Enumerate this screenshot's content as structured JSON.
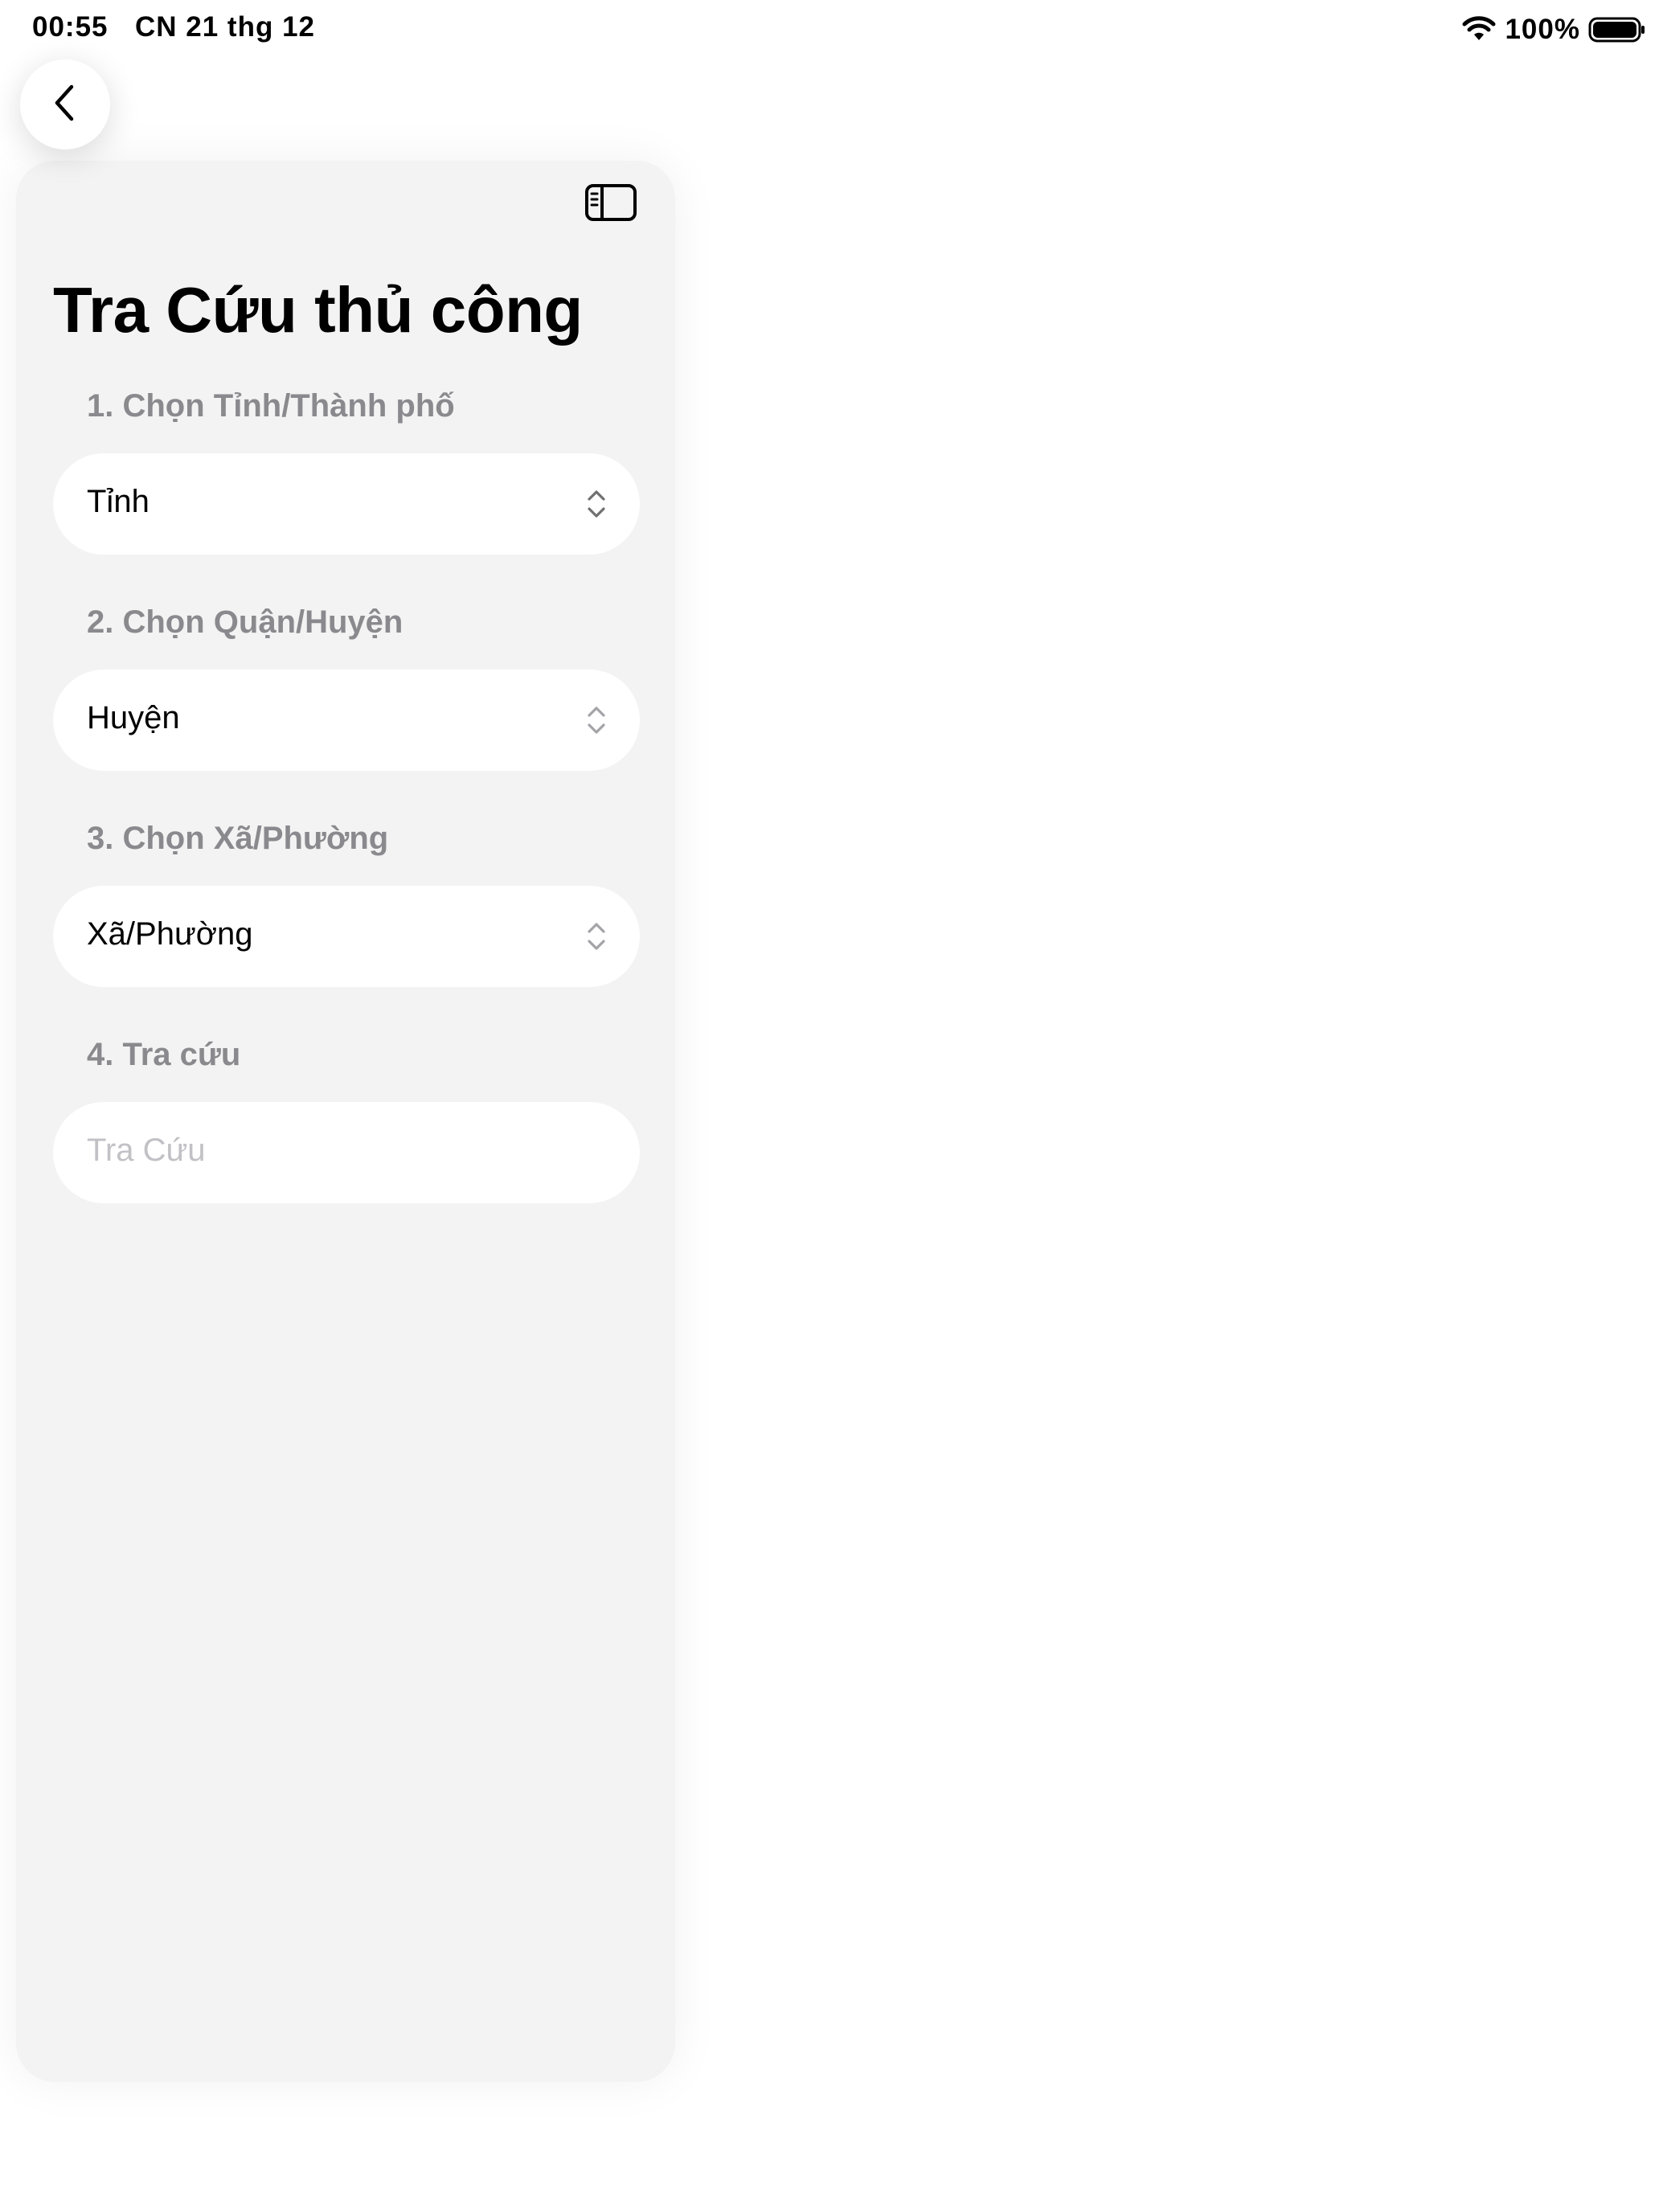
{
  "status_bar": {
    "time": "00:55",
    "date": "CN 21 thg 12",
    "battery": "100%"
  },
  "icons": {
    "back": "chevron-left-icon",
    "sidebar_toggle": "sidebar-icon",
    "picker_indicator": "chevron-up-down-icon",
    "wifi": "wifi-icon",
    "battery": "battery-icon"
  },
  "title": "Tra Cứu thủ công",
  "sections": [
    {
      "label": "1. Chọn Tỉnh/Thành phố",
      "value": "Tỉnh"
    },
    {
      "label": "2. Chọn Quận/Huyện",
      "value": "Huyện"
    },
    {
      "label": "3. Chọn Xã/Phường",
      "value": "Xã/Phường"
    },
    {
      "label": "4. Tra cứu",
      "placeholder": "Tra Cứu"
    }
  ],
  "colors": {
    "panel_background": "#f3f3f3",
    "field_background": "#ffffff",
    "label_gray": "#8a8a8e",
    "placeholder_gray": "#c1c1c6"
  }
}
